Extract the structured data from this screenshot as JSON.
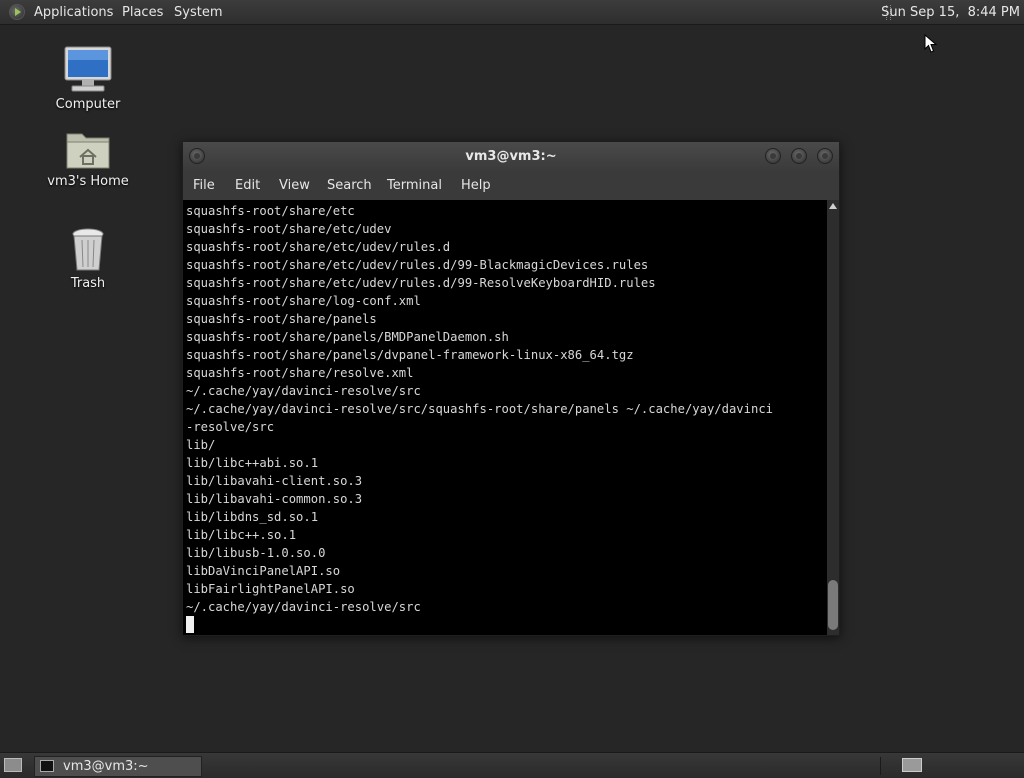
{
  "top_panel": {
    "menus": [
      "Applications",
      "Places",
      "System"
    ],
    "clock": "Sun Sep 15,  8:44 PM"
  },
  "desktop": {
    "icons": [
      {
        "label": "Computer",
        "icon": "computer-icon"
      },
      {
        "label": "vm3's Home",
        "icon": "home-folder-icon"
      },
      {
        "label": "Trash",
        "icon": "trash-icon"
      }
    ]
  },
  "terminal": {
    "title": "vm3@vm3:~",
    "menu": [
      "File",
      "Edit",
      "View",
      "Search",
      "Terminal",
      "Help"
    ],
    "lines": [
      "squashfs-root/share/etc",
      "squashfs-root/share/etc/udev",
      "squashfs-root/share/etc/udev/rules.d",
      "squashfs-root/share/etc/udev/rules.d/99-BlackmagicDevices.rules",
      "squashfs-root/share/etc/udev/rules.d/99-ResolveKeyboardHID.rules",
      "squashfs-root/share/log-conf.xml",
      "squashfs-root/share/panels",
      "squashfs-root/share/panels/BMDPanelDaemon.sh",
      "squashfs-root/share/panels/dvpanel-framework-linux-x86_64.tgz",
      "squashfs-root/share/resolve.xml",
      "~/.cache/yay/davinci-resolve/src",
      "~/.cache/yay/davinci-resolve/src/squashfs-root/share/panels ~/.cache/yay/davinci",
      "-resolve/src",
      "lib/",
      "lib/libc++abi.so.1",
      "lib/libavahi-client.so.3",
      "lib/libavahi-common.so.3",
      "lib/libdns_sd.so.1",
      "lib/libc++.so.1",
      "lib/libusb-1.0.so.0",
      "libDaVinciPanelAPI.so",
      "libFairlightPanelAPI.so",
      "~/.cache/yay/davinci-resolve/src"
    ]
  },
  "bottom_panel": {
    "task_label": "vm3@vm3:~"
  },
  "colors": {
    "desktop_bg": "#262626",
    "terminal_bg": "#000000",
    "terminal_fg": "#d8d8d8"
  }
}
